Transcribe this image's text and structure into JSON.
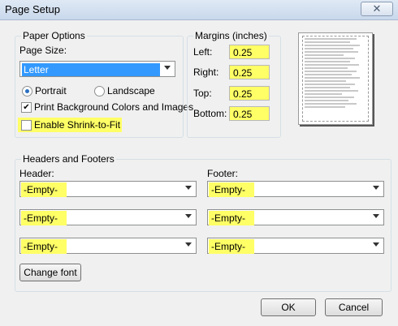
{
  "window": {
    "title": "Page Setup",
    "close_glyph": "✕"
  },
  "paper_options": {
    "legend": "Paper Options",
    "page_size_label": "Page Size:",
    "page_size_value": "Letter",
    "orientation": {
      "portrait_label": "Portrait",
      "landscape_label": "Landscape",
      "selected": "Portrait"
    },
    "print_background_label": "Print Background Colors and Images",
    "print_background_checked": true,
    "shrink_to_fit_label": "Enable Shrink-to-Fit",
    "shrink_to_fit_checked": false
  },
  "margins": {
    "legend": "Margins (inches)",
    "left_label": "Left:",
    "left_value": "0.25",
    "right_label": "Right:",
    "right_value": "0.25",
    "top_label": "Top:",
    "top_value": "0.25",
    "bottom_label": "Bottom:",
    "bottom_value": "0.25"
  },
  "headers_footers": {
    "legend": "Headers and Footers",
    "header_label": "Header:",
    "footer_label": "Footer:",
    "header_values": [
      "-Empty-",
      "-Empty-",
      "-Empty-"
    ],
    "footer_values": [
      "-Empty-",
      "-Empty-",
      "-Empty-"
    ],
    "change_font_label": "Change font"
  },
  "buttons": {
    "ok_label": "OK",
    "cancel_label": "Cancel"
  },
  "colors": {
    "highlight": "#ffff66",
    "selection": "#3399ff"
  }
}
